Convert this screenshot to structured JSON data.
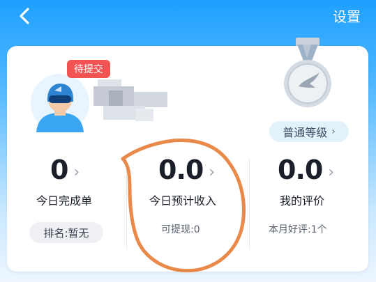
{
  "header": {
    "back_icon": "chevron-left-icon",
    "settings_label": "设置"
  },
  "profile": {
    "status_badge": "待提交",
    "avatar_icon": "courier-avatar-icon",
    "name_redacted": true
  },
  "level": {
    "medal_icon": "silver-medal-bird-icon",
    "label": "普通等级",
    "chevron": "›"
  },
  "stats": [
    {
      "value": "0",
      "arrow": "›",
      "label": "今日完成单",
      "footer": "排名:暂无"
    },
    {
      "value": "0.0",
      "arrow": "›",
      "label": "今日预计收入",
      "footer": "可提现:0"
    },
    {
      "value": "0.0",
      "arrow": "›",
      "label": "我的评价",
      "footer": "本月好评:1个"
    }
  ],
  "annotation": {
    "color": "#e9894a"
  },
  "colors": {
    "badge": "#f25454",
    "header": "#1ea0ff"
  }
}
